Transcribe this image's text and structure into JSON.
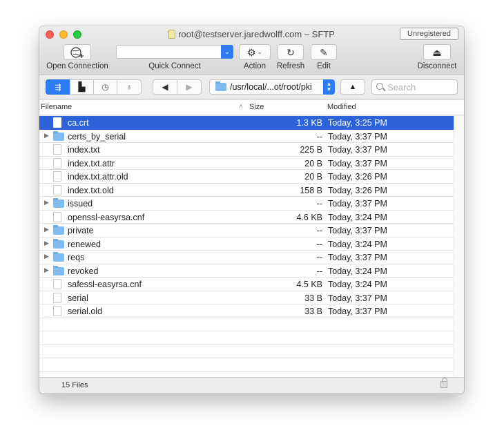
{
  "window": {
    "title": "root@testserver.jaredwolff.com – SFTP",
    "badge": "Unregistered"
  },
  "toolbar": {
    "open_connection": "Open Connection",
    "quick_connect": "Quick Connect",
    "action": "Action",
    "refresh": "Refresh",
    "edit": "Edit",
    "disconnect": "Disconnect",
    "quick_connect_value": ""
  },
  "pathbar": {
    "path": "/usr/local/...ot/root/pki",
    "search_placeholder": "Search",
    "back": "◀",
    "forward": "▶",
    "up": "▲"
  },
  "columns": {
    "filename": "Filename",
    "size": "Size",
    "modified": "Modified",
    "sort_indicator": "˄"
  },
  "files": [
    {
      "name": "ca.crt",
      "size": "1.3 KB",
      "modified": "Today, 3:25 PM",
      "type": "file",
      "selected": true
    },
    {
      "name": "certs_by_serial",
      "size": "--",
      "modified": "Today, 3:37 PM",
      "type": "folder"
    },
    {
      "name": "index.txt",
      "size": "225 B",
      "modified": "Today, 3:37 PM",
      "type": "file"
    },
    {
      "name": "index.txt.attr",
      "size": "20 B",
      "modified": "Today, 3:37 PM",
      "type": "file"
    },
    {
      "name": "index.txt.attr.old",
      "size": "20 B",
      "modified": "Today, 3:26 PM",
      "type": "file"
    },
    {
      "name": "index.txt.old",
      "size": "158 B",
      "modified": "Today, 3:26 PM",
      "type": "file"
    },
    {
      "name": "issued",
      "size": "--",
      "modified": "Today, 3:37 PM",
      "type": "folder"
    },
    {
      "name": "openssl-easyrsa.cnf",
      "size": "4.6 KB",
      "modified": "Today, 3:24 PM",
      "type": "file"
    },
    {
      "name": "private",
      "size": "--",
      "modified": "Today, 3:37 PM",
      "type": "folder"
    },
    {
      "name": "renewed",
      "size": "--",
      "modified": "Today, 3:24 PM",
      "type": "folder"
    },
    {
      "name": "reqs",
      "size": "--",
      "modified": "Today, 3:37 PM",
      "type": "folder"
    },
    {
      "name": "revoked",
      "size": "--",
      "modified": "Today, 3:24 PM",
      "type": "folder"
    },
    {
      "name": "safessl-easyrsa.cnf",
      "size": "4.5 KB",
      "modified": "Today, 3:24 PM",
      "type": "file"
    },
    {
      "name": "serial",
      "size": "33 B",
      "modified": "Today, 3:37 PM",
      "type": "file"
    },
    {
      "name": "serial.old",
      "size": "33 B",
      "modified": "Today, 3:37 PM",
      "type": "file"
    }
  ],
  "empty_rows": 5,
  "status": {
    "file_count": "15 Files"
  },
  "colors": {
    "accent": "#2d7cf6",
    "selection": "#2d62d8",
    "folder": "#7fbdf0"
  }
}
